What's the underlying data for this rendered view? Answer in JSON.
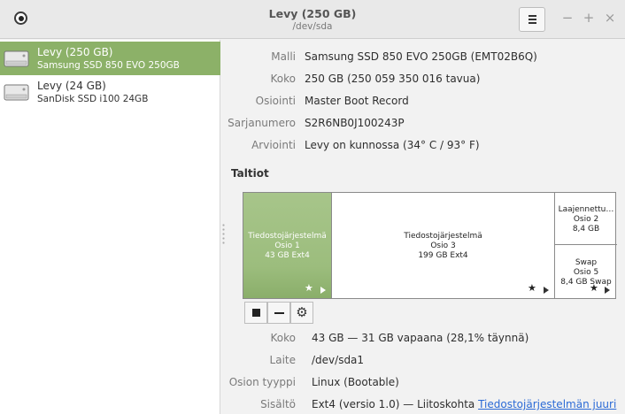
{
  "window": {
    "title": "Levy (250 GB)",
    "subtitle": "/dev/sda",
    "minimize": "−",
    "maximize": "+",
    "close": "×"
  },
  "drives": [
    {
      "name": "Levy (250 GB)",
      "model": "Samsung SSD 850 EVO 250GB",
      "selected": true
    },
    {
      "name": "Levy (24 GB)",
      "model": "SanDisk SSD i100 24GB",
      "selected": false
    }
  ],
  "disk_info": [
    {
      "label": "Malli",
      "value": "Samsung SSD 850 EVO 250GB (EMT02B6Q)"
    },
    {
      "label": "Koko",
      "value": "250 GB (250 059 350 016 tavua)"
    },
    {
      "label": "Osiointi",
      "value": "Master Boot Record"
    },
    {
      "label": "Sarjanumero",
      "value": "S2R6NB0J100243P"
    },
    {
      "label": "Arviointi",
      "value": "Levy on kunnossa (34° C / 93° F)"
    }
  ],
  "volumes_title": "Taltiot",
  "volumes": {
    "p1": {
      "line1": "Tiedostojärjestelmä",
      "line2": "Osio 1",
      "line3": "43 GB Ext4"
    },
    "p3": {
      "line1": "Tiedostojärjestelmä",
      "line2": "Osio 3",
      "line3": "199 GB Ext4"
    },
    "p2": {
      "line1": "Laajennettu…",
      "line2": "Osio 2",
      "line3": "8,4 GB"
    },
    "p5": {
      "line1": "Swap",
      "line2": "Osio 5",
      "line3": "8,4 GB Swap"
    }
  },
  "volume_info": [
    {
      "label": "Koko",
      "value": "43 GB — 31 GB vapaana (28,1% täynnä)"
    },
    {
      "label": "Laite",
      "value": "/dev/sda1"
    },
    {
      "label": "Osion tyyppi",
      "value": "Linux (Bootable)"
    },
    {
      "label": "Sisältö",
      "value": "Ext4 (versio 1.0) — Liitoskohta ",
      "link": "Tiedostojärjestelmän juuri"
    }
  ],
  "icons": {
    "app": "disks-app-icon",
    "menu": "hamburger-menu-icon",
    "drive": "hard-drive-icon",
    "star": "star-icon",
    "play": "play-icon",
    "stop": "stop-icon",
    "minus": "minus-icon",
    "gear": "gear-icon"
  },
  "colors": {
    "selection": "#8cb168",
    "link": "#2b6ad6"
  }
}
